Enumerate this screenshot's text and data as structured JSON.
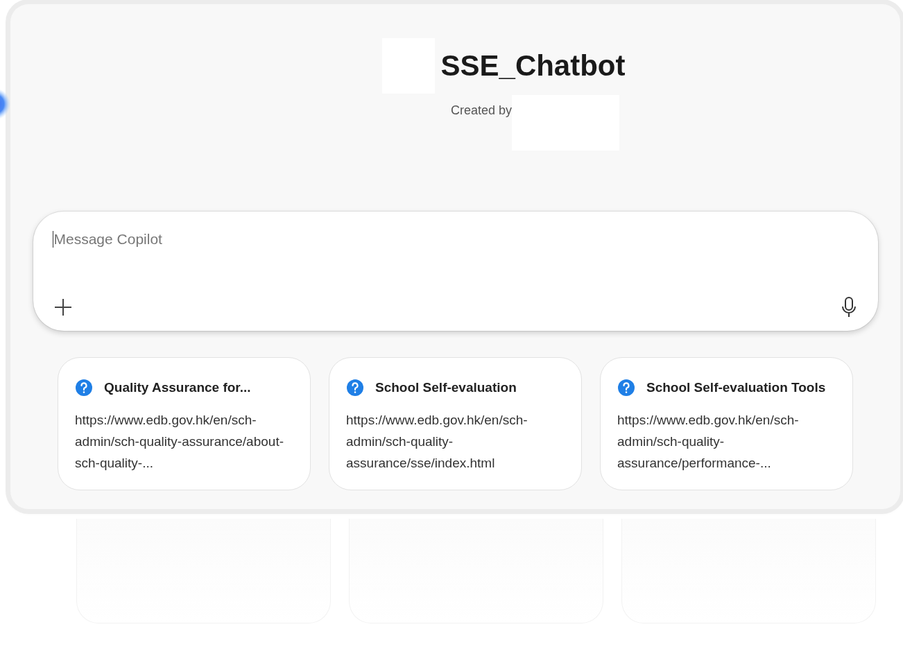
{
  "header": {
    "title": "SSE_Chatbot",
    "subtitle": "Created by"
  },
  "composer": {
    "placeholder": "Message Copilot"
  },
  "suggestions": [
    {
      "title": "Quality Assurance for...",
      "url": "https://www.edb.gov.hk/en/sch-admin/sch-quality-assurance/about-sch-quality-..."
    },
    {
      "title": "School Self-evaluation",
      "url": "https://www.edb.gov.hk/en/sch-admin/sch-quality-assurance/sse/index.html"
    },
    {
      "title": "School Self-evaluation Tools",
      "url": "https://www.edb.gov.hk/en/sch-admin/sch-quality-assurance/performance-..."
    }
  ]
}
